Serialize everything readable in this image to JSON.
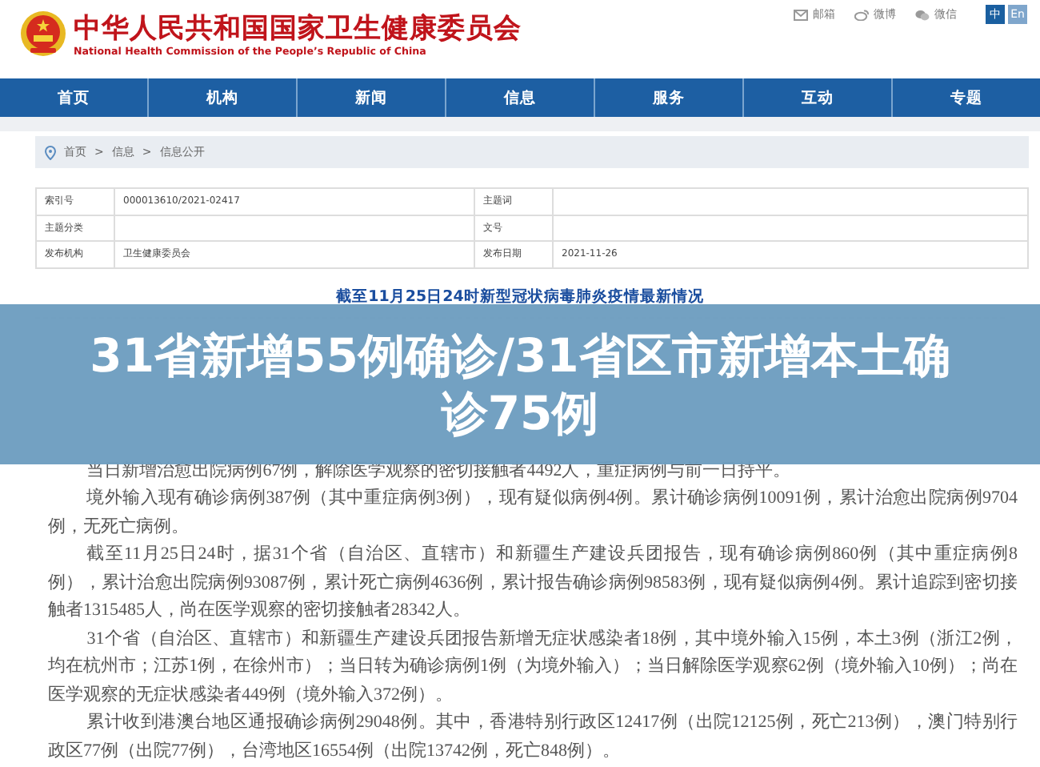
{
  "header": {
    "title": "中华人民共和国国家卫生健康委员会",
    "subtitle": "National Health Commission of the People’s Republic of China",
    "links": [
      {
        "kind": "mail",
        "label": "邮箱"
      },
      {
        "kind": "weibo",
        "label": "微博"
      },
      {
        "kind": "wechat",
        "label": "微信"
      }
    ],
    "languages": [
      {
        "label": "中",
        "selected": true
      },
      {
        "label": "En",
        "selected": false
      }
    ]
  },
  "nav": [
    "首页",
    "机构",
    "新闻",
    "信息",
    "服务",
    "互动",
    "专题"
  ],
  "breadcrumb": {
    "items": [
      "首页",
      "信息",
      "信息公开"
    ],
    "separator": ">"
  },
  "metadata": [
    [
      {
        "label": "索引号",
        "value": "000013610/2021-02417"
      },
      {
        "label": "主题词"
      }
    ],
    [
      {
        "label": "主题分类"
      },
      {
        "label": "文号"
      }
    ],
    [
      {
        "label": "发布机构",
        "value": "卫生健康委员会"
      },
      {
        "label": "发布日期",
        "value": "2021-11-26"
      }
    ]
  ],
  "article": {
    "title": "截至11月25日24时新型冠状病毒肺炎疫情最新情况",
    "paragraphs": [
      "当日新增治愈出院病例67例，解除医学观察的密切接触者4492人，重症病例与前一日持平。",
      "境外输入现有确诊病例387例（其中重症病例3例），现有疑似病例4例。累计确诊病例10091例，累计治愈出院病例9704例，无死亡病例。",
      "截至11月25日24时，据31个省（自治区、直辖市）和新疆生产建设兵团报告，现有确诊病例860例（其中重症病例8例），累计治愈出院病例93087例，累计死亡病例4636例，累计报告确诊病例98583例，现有疑似病例4例。累计追踪到密切接触者1315485人，尚在医学观察的密切接触者28342人。",
      "31个省（自治区、直辖市）和新疆生产建设兵团报告新增无症状感染者18例，其中境外输入15例，本土3例（浙江2例，均在杭州市；江苏1例，在徐州市）；当日转为确诊病例1例（为境外输入）；当日解除医学观察62例（境外输入10例）；尚在医学观察的无症状感染者449例（境外输入372例）。",
      "累计收到港澳台地区通报确诊病例29048例。其中，香港特别行政区12417例（出院12125例，死亡213例），澳门特别行政区77例（出院77例），台湾地区16554例（出院13742例，死亡848例）。"
    ]
  },
  "banner": {
    "headline": "31省新增55例确诊/31省区市新增本土确诊75例"
  }
}
